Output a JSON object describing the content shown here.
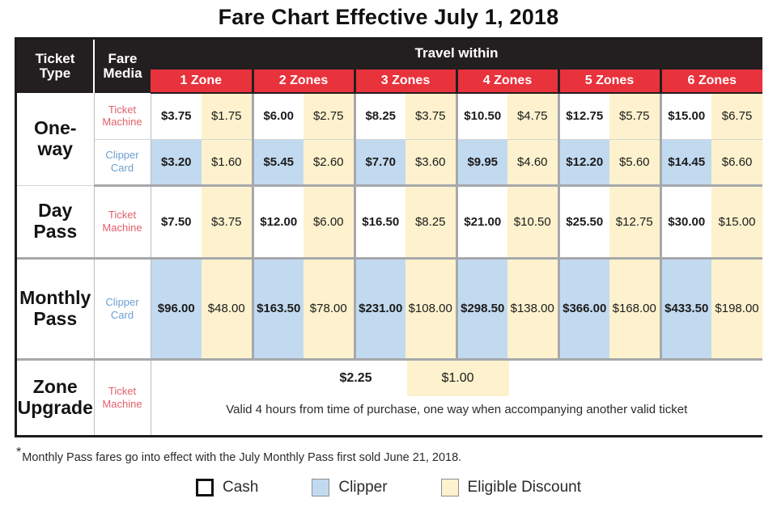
{
  "title": "Fare Chart Effective July 1, 2018",
  "header": {
    "ticket_type": "Ticket\nType",
    "ticket_type_line1": "Ticket",
    "ticket_type_line2": "Type",
    "fare_media_line1": "Fare",
    "fare_media_line2": "Media",
    "travel_within": "Travel within",
    "zones": [
      "1 Zone",
      "2 Zones",
      "3 Zones",
      "4 Zones",
      "5 Zones",
      "6 Zones"
    ]
  },
  "media": {
    "ticket_machine_line1": "Ticket",
    "ticket_machine_line2": "Machine",
    "clipper_card_line1": "Clipper",
    "clipper_card_line2": "Card"
  },
  "rows": {
    "oneway": {
      "type_line1": "One-",
      "type_line2": "way",
      "ticket_machine": {
        "cash": [
          "$3.75",
          "$6.00",
          "$8.25",
          "$10.50",
          "$12.75",
          "$15.00"
        ],
        "discount": [
          "$1.75",
          "$2.75",
          "$3.75",
          "$4.75",
          "$5.75",
          "$6.75"
        ]
      },
      "clipper_card": {
        "cash": [
          "$3.20",
          "$5.45",
          "$7.70",
          "$9.95",
          "$12.20",
          "$14.45"
        ],
        "discount": [
          "$1.60",
          "$2.60",
          "$3.60",
          "$4.60",
          "$5.60",
          "$6.60"
        ]
      }
    },
    "daypass": {
      "type_line1": "Day",
      "type_line2": "Pass",
      "ticket_machine": {
        "cash": [
          "$7.50",
          "$12.00",
          "$16.50",
          "$21.00",
          "$25.50",
          "$30.00"
        ],
        "discount": [
          "$3.75",
          "$6.00",
          "$8.25",
          "$10.50",
          "$12.75",
          "$15.00"
        ]
      }
    },
    "monthly": {
      "type_line1": "Monthly",
      "type_line2": "Pass",
      "clipper_card": {
        "cash": [
          "$96.00",
          "$163.50",
          "$231.00",
          "$298.50",
          "$366.00",
          "$433.50"
        ],
        "discount": [
          "$48.00",
          "$78.00",
          "$108.00",
          "$138.00",
          "$168.00",
          "$198.00"
        ]
      }
    },
    "zone_upgrade": {
      "type_line1": "Zone",
      "type_line2": "Upgrade",
      "cash": "$2.25",
      "discount": "$1.00",
      "note": "Valid 4 hours from time of purchase, one way when accompanying another valid ticket"
    }
  },
  "footnote": {
    "star": "*",
    "text": "Monthly Pass fares go into effect with the July Monthly Pass first sold June 21, 2018."
  },
  "legend": [
    {
      "label": "Cash",
      "swatch": "cash"
    },
    {
      "label": "Clipper",
      "swatch": "clipper"
    },
    {
      "label": "Eligible Discount",
      "swatch": "discount"
    }
  ],
  "colors": {
    "header_black": "#231f20",
    "zone_red": "#e8323c",
    "clipper_blue": "#c2daf0",
    "discount_yellow": "#fdf2cd",
    "ticket_machine_text": "#e2606a",
    "clipper_card_text": "#6b9fd0"
  }
}
